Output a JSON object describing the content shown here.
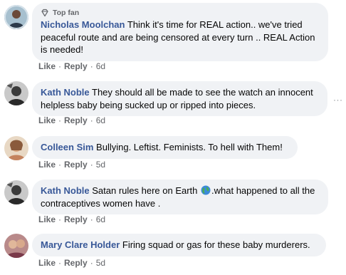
{
  "comments": [
    {
      "badge": "Top fan",
      "author": "Nicholas Moolchan",
      "text": "Think it's time for REAL action.. we've tried peaceful route and are being censored at every turn .. REAL Action is needed!",
      "like": "Like",
      "reply": "Reply",
      "time": "6d"
    },
    {
      "author": "Kath Noble",
      "text": "They should all be made to see the watch an innocent helpless baby being sucked up or ripped into pieces.",
      "like": "Like",
      "reply": "Reply",
      "time": "6d",
      "more": "···"
    },
    {
      "author": "Colleen Sim",
      "text": "Bullying. Leftist. Feminists. To hell with Them!",
      "like": "Like",
      "reply": "Reply",
      "time": "5d"
    },
    {
      "author": "Kath Noble",
      "text_before": "Satan rules here on Earth ",
      "text_after": ".what happened to all the contraceptives women have .",
      "emoji_icon": "globe-icon",
      "like": "Like",
      "reply": "Reply",
      "time": "6d"
    },
    {
      "author": "Mary Clare Holder",
      "text": "Firing squad or gas for these baby murderers.",
      "like": "Like",
      "reply": "Reply",
      "time": "5d"
    }
  ],
  "separator": "·",
  "colors": {
    "author": "#385898",
    "bubble": "#f0f2f5",
    "meta": "#65676b"
  }
}
